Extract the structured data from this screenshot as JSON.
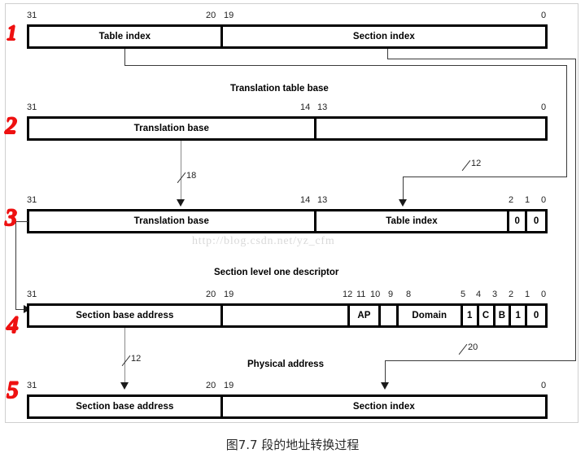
{
  "figure": {
    "caption": "图7.7   段的地址转换过程",
    "watermark": "http://blog.csdn.net/yz_cfm"
  },
  "steps": [
    {
      "label": "1"
    },
    {
      "label": "2"
    },
    {
      "label": "3"
    },
    {
      "label": "4"
    },
    {
      "label": "5"
    }
  ],
  "section_titles": {
    "translation_table_base": "Translation table base",
    "section_level_one_descriptor": "Section level one descriptor",
    "physical_address": "Physical address"
  },
  "rows": [
    {
      "id": "virtual-address",
      "bit_labels": [
        "31",
        "20",
        "19",
        "0"
      ],
      "cells": [
        {
          "label": "Table index",
          "bits": "31-20"
        },
        {
          "label": "Section index",
          "bits": "19-0"
        }
      ]
    },
    {
      "id": "translation-table-base-register",
      "bit_labels": [
        "31",
        "14",
        "13",
        "0"
      ],
      "cells": [
        {
          "label": "Translation base",
          "bits": "31-14"
        },
        {
          "label": "",
          "bits": "13-0"
        }
      ]
    },
    {
      "id": "first-level-descriptor-address",
      "bit_labels": [
        "31",
        "14",
        "13",
        "2",
        "1",
        "0"
      ],
      "cells": [
        {
          "label": "Translation base",
          "bits": "31-14"
        },
        {
          "label": "Table index",
          "bits": "13-2"
        },
        {
          "label": "0",
          "bits": "1"
        },
        {
          "label": "0",
          "bits": "0"
        }
      ]
    },
    {
      "id": "section-descriptor",
      "bit_labels": [
        "31",
        "20",
        "19",
        "12",
        "11",
        "10",
        "9",
        "8",
        "5",
        "4",
        "3",
        "2",
        "1",
        "0"
      ],
      "cells": [
        {
          "label": "Section base address",
          "bits": "31-20"
        },
        {
          "label": "",
          "bits": "19-12"
        },
        {
          "label": "AP",
          "bits": "11-10"
        },
        {
          "label": "",
          "bits": "9"
        },
        {
          "label": "Domain",
          "bits": "8-5"
        },
        {
          "label": "1",
          "bits": "4"
        },
        {
          "label": "C",
          "bits": "3"
        },
        {
          "label": "B",
          "bits": "2"
        },
        {
          "label": "1",
          "bits": "1"
        },
        {
          "label": "0",
          "bits": "0"
        }
      ]
    },
    {
      "id": "physical-address",
      "bit_labels": [
        "31",
        "20",
        "19",
        "0"
      ],
      "cells": [
        {
          "label": "Section base address",
          "bits": "31-20"
        },
        {
          "label": "Section index",
          "bits": "19-0"
        }
      ]
    }
  ],
  "bus_widths": [
    {
      "label": "18",
      "from": "translation-base",
      "to": "descriptor-address-base"
    },
    {
      "label": "12",
      "from": "table-index",
      "to": "descriptor-address-index"
    },
    {
      "label": "12",
      "from": "section-base-address",
      "to": "physical-base"
    },
    {
      "label": "20",
      "from": "section-index",
      "to": "physical-index"
    }
  ]
}
